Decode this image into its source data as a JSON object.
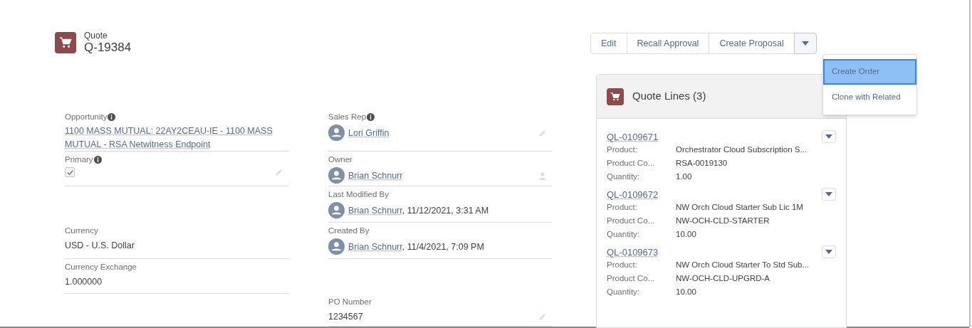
{
  "header": {
    "object_type": "Quote",
    "record_name": "Q-19384"
  },
  "actions": {
    "buttons": [
      "Edit",
      "Recall Approval",
      "Create Proposal"
    ],
    "menu_open": true,
    "menu_items": [
      {
        "label": "Create Order",
        "selected": true
      },
      {
        "label": "Clone with Related",
        "selected": false
      }
    ]
  },
  "detail_rows": [
    {
      "left": {
        "label": "Opportunity",
        "info": true,
        "kind": "link",
        "value": "1100 MASS MUTUAL: 22AY2CEAU-IE - 1100 MASS MUTUAL - RSA Netwitness Endpoint"
      },
      "right": {
        "label": "Sales Rep",
        "info": true,
        "kind": "user",
        "value": "Lori Griffin",
        "edit": true
      }
    },
    {
      "left": {
        "label": "Primary",
        "info": true,
        "kind": "checkbox",
        "checked": true,
        "edit": true
      },
      "right": {
        "label": "Owner",
        "kind": "user",
        "value": "Brian Schnurr",
        "change_owner": true
      }
    },
    {
      "right": {
        "label": "Last Modified By",
        "kind": "user",
        "value": "Brian Schnurr",
        "suffix": ", 11/12/2021, 3:31 AM"
      }
    },
    {
      "left": {
        "label": "Currency",
        "kind": "text",
        "value": "USD - U.S. Dollar"
      },
      "right": {
        "label": "Created By",
        "kind": "user",
        "value": "Brian Schnurr",
        "suffix": ", 11/4/2021, 7:09 PM"
      }
    },
    {
      "left": {
        "label": "Currency Exchange",
        "kind": "text",
        "value": "1.000000"
      }
    },
    {
      "right": {
        "label": "PO Number",
        "kind": "text",
        "value": "1234567",
        "edit": true
      }
    }
  ],
  "quote_lines": {
    "title": "Quote Lines (3)",
    "items": [
      {
        "id": "QL-0109671",
        "fields": [
          {
            "label": "Product:",
            "value": "Orchestrator Cloud Subscription S..."
          },
          {
            "label": "Product Co...",
            "value": "RSA-0019130"
          },
          {
            "label": "Quantity:",
            "value": "1.00"
          }
        ]
      },
      {
        "id": "QL-0109672",
        "fields": [
          {
            "label": "Product:",
            "value": "NW Orch Cloud Starter Sub Lic 1M"
          },
          {
            "label": "Product Co...",
            "value": "NW-OCH-CLD-STARTER"
          },
          {
            "label": "Quantity:",
            "value": "10.00"
          }
        ]
      },
      {
        "id": "QL-0109673",
        "fields": [
          {
            "label": "Product:",
            "value": "NW Orch Cloud Starter To Std Sub..."
          },
          {
            "label": "Product Co...",
            "value": "NW-OCH-CLD-UPGRD-A"
          },
          {
            "label": "Quantity:",
            "value": "10.00"
          }
        ]
      }
    ]
  }
}
